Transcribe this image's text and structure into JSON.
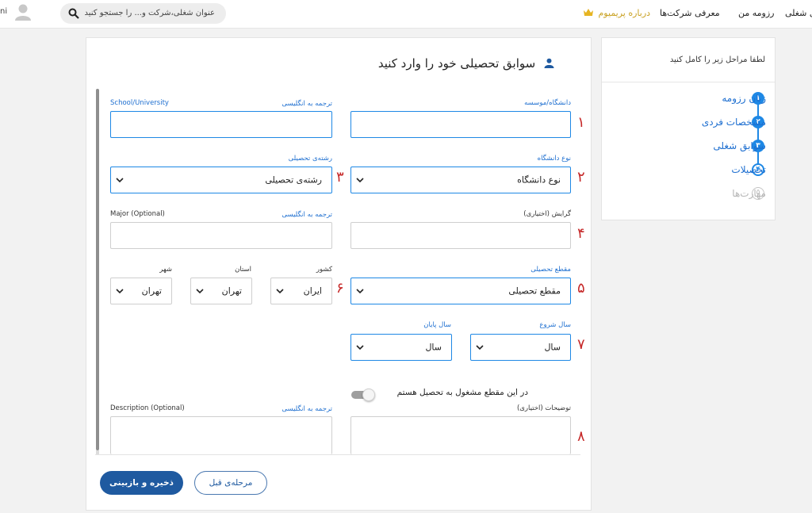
{
  "header": {
    "nav": [
      "رزومه من",
      "معرفی شرکت‌ها",
      "درباره پریمیوم"
    ],
    "nav_partial": "های شغلی",
    "search_placeholder": "عنوان شغلی،شرکت و... را جستجو کنید",
    "user_partial": "ni"
  },
  "sidebar": {
    "header": "لطفا مراحل زیر را کامل کنید",
    "steps": [
      {
        "num": "۱",
        "label": "زبان رزومه",
        "state": "done"
      },
      {
        "num": "۲",
        "label": "مشخصات فردی",
        "state": "done"
      },
      {
        "num": "۳",
        "label": "سوابق شغلی",
        "state": "done"
      },
      {
        "num": "۴",
        "label": "تحصیلات",
        "state": "current"
      },
      {
        "num": "۵",
        "label": "مهارت‌ها",
        "state": "pending"
      }
    ]
  },
  "form": {
    "title": "سوابق تحصیلی خود را وارد کنید",
    "university_label": "دانشگاه/موسسه",
    "translate_label": "ترجمه به انگلیسی",
    "school_en_label": "School/University",
    "university_type_label": "نوع دانشگاه",
    "university_type_value": "نوع دانشگاه",
    "major_label": "رشته‌ی تحصیلی",
    "major_value": "رشته‌ی تحصیلی",
    "orientation_label": "گرایش (اختیاری)",
    "major_en_label": "Major (Optional)",
    "degree_label": "مقطع تحصیلی",
    "degree_value": "مقطع تحصیلی",
    "country_label": "کشور",
    "country_value": "ایران",
    "province_label": "استان",
    "province_value": "تهران",
    "city_label": "شهر",
    "city_value": "تهران",
    "start_year_label": "سال شروع",
    "start_year_value": "سال",
    "end_year_label": "سال پایان",
    "end_year_value": "سال",
    "studying_label": "در این مقطع مشغول به تحصیل هستم",
    "description_label": "توضیحات (اختیاری)",
    "description_en_label": "Description (Optional)",
    "annotations": [
      "۱",
      "۲",
      "۳",
      "۴",
      "۵",
      "۶",
      "۷",
      "۸"
    ]
  },
  "buttons": {
    "save": "ذخیره و بازبینی",
    "previous": "مرحله‌ی قبل"
  },
  "colors": {
    "accent": "#1e88e5",
    "primary_button": "#1f5aa0",
    "annotation": "#c62828",
    "premium": "#c9a224"
  }
}
